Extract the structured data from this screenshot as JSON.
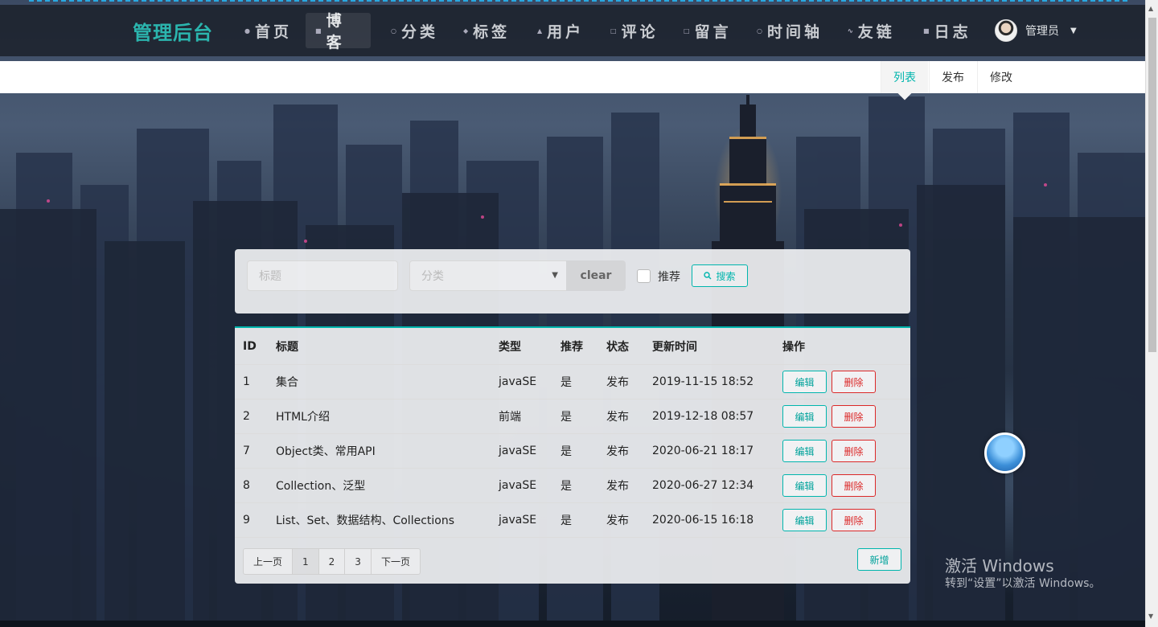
{
  "nav": {
    "brand": "管理后台",
    "items": [
      {
        "label": "首页",
        "icon": "home-icon"
      },
      {
        "label": "博客",
        "icon": "blog-icon"
      },
      {
        "label": "分类",
        "icon": "category-icon"
      },
      {
        "label": "标签",
        "icon": "tag-icon"
      },
      {
        "label": "用户",
        "icon": "user-icon"
      },
      {
        "label": "评论",
        "icon": "comment-icon"
      },
      {
        "label": "留言",
        "icon": "message-icon"
      },
      {
        "label": "时间轴",
        "icon": "timeline-icon"
      },
      {
        "label": "友链",
        "icon": "link-icon"
      },
      {
        "label": "日志",
        "icon": "log-icon"
      }
    ],
    "active": "博客",
    "user_name": "管理员"
  },
  "subnav": {
    "tabs": [
      "列表",
      "发布",
      "修改"
    ],
    "active": "列表"
  },
  "search": {
    "title_placeholder": "标题",
    "category_placeholder": "分类",
    "clear_label": "clear",
    "recommend_label": "推荐",
    "search_label": "搜索"
  },
  "table": {
    "headers": [
      "ID",
      "标题",
      "类型",
      "推荐",
      "状态",
      "更新时间",
      "操作"
    ],
    "rows": [
      {
        "id": "1",
        "title": "集合",
        "type": "javaSE",
        "recommend": "是",
        "status": "发布",
        "updated": "2019-11-15 18:52"
      },
      {
        "id": "2",
        "title": "HTML介绍",
        "type": "前端",
        "recommend": "是",
        "status": "发布",
        "updated": "2019-12-18 08:57"
      },
      {
        "id": "7",
        "title": "Object类、常用API",
        "type": "javaSE",
        "recommend": "是",
        "status": "发布",
        "updated": "2020-06-21 18:17"
      },
      {
        "id": "8",
        "title": "Collection、泛型",
        "type": "javaSE",
        "recommend": "是",
        "status": "发布",
        "updated": "2020-06-27 12:34"
      },
      {
        "id": "9",
        "title": "List、Set、数据结构、Collections",
        "type": "javaSE",
        "recommend": "是",
        "status": "发布",
        "updated": "2020-06-15 16:18"
      }
    ],
    "edit_label": "编辑",
    "delete_label": "删除"
  },
  "pagination": {
    "prev_label": "上一页",
    "pages": [
      "1",
      "2",
      "3"
    ],
    "current": "1",
    "next_label": "下一页"
  },
  "add_label": "新增",
  "watermark": {
    "line1": "激活 Windows",
    "line2": "转到“设置”以激活 Windows。"
  },
  "colors": {
    "accent": "#00b5ad",
    "danger": "#db2828",
    "brand": "#2bb5ae"
  }
}
